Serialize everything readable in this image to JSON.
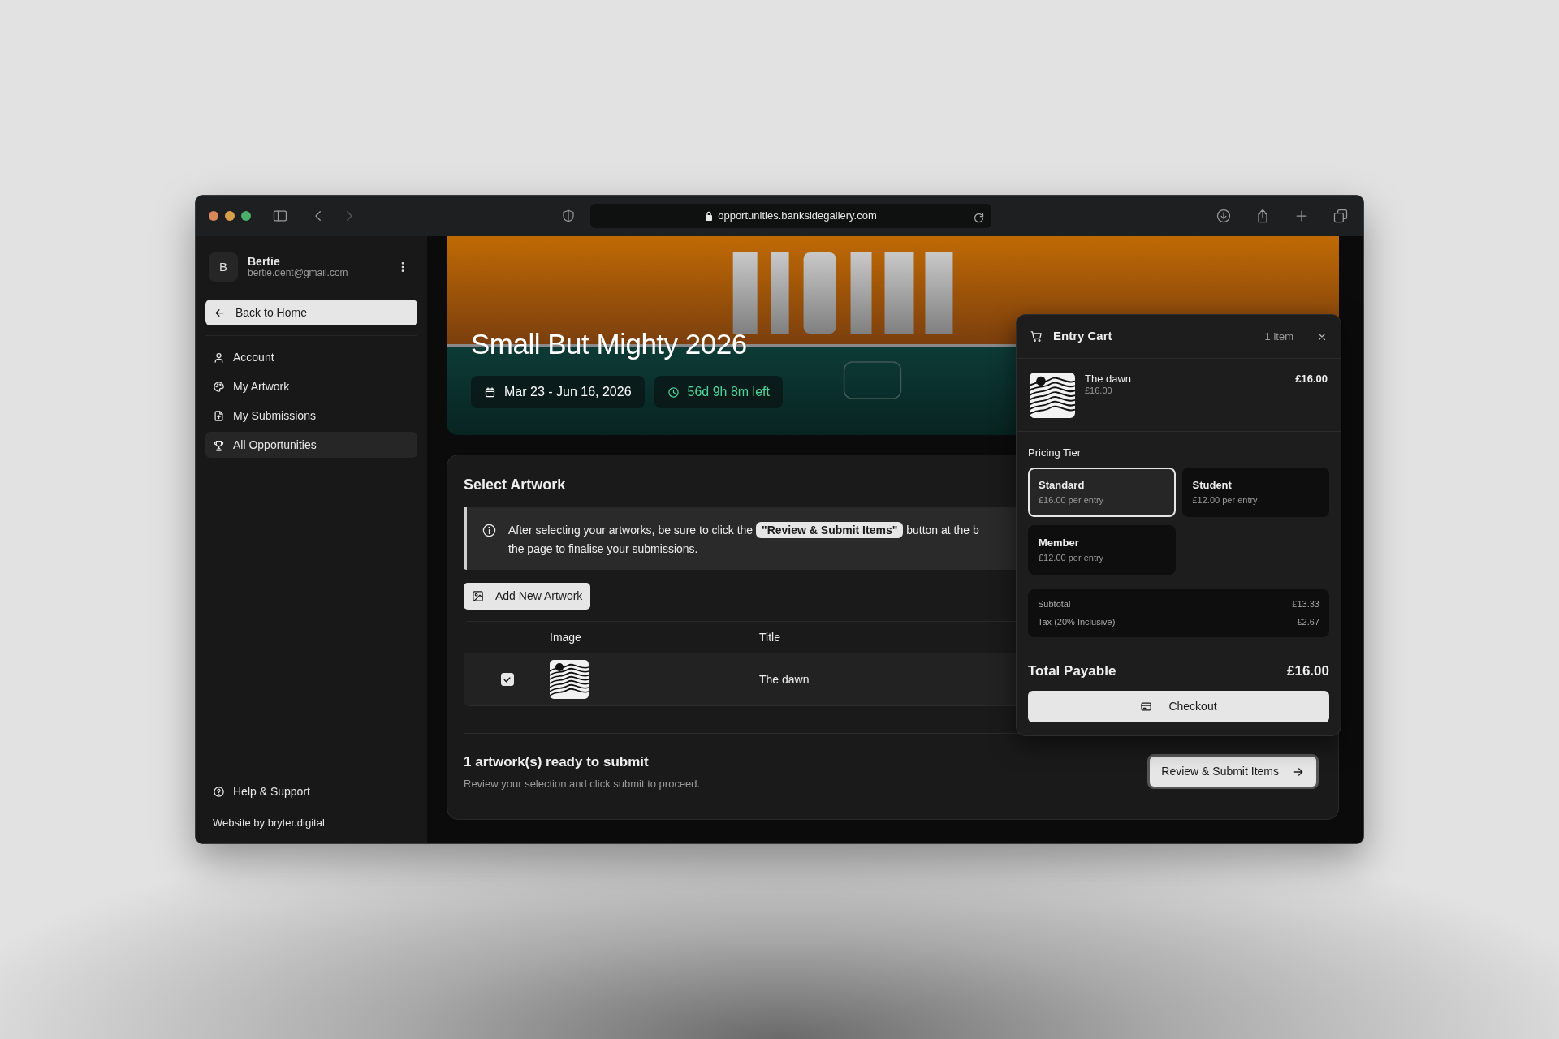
{
  "browser": {
    "url": "opportunities.banksidegallery.com"
  },
  "user": {
    "initial": "B",
    "name": "Bertie",
    "email": "bertie.dent@gmail.com"
  },
  "back_button": "Back to Home",
  "nav": [
    {
      "kind": "user",
      "label": "Account",
      "selected": false
    },
    {
      "kind": "palette",
      "label": "My Artwork",
      "selected": false
    },
    {
      "kind": "file",
      "label": "My Submissions",
      "selected": false
    },
    {
      "kind": "trophy",
      "label": "All Opportunities",
      "selected": true
    }
  ],
  "help": "Help & Support",
  "credit": "Website by bryter.digital",
  "banner": {
    "title": "Small But Mighty 2026",
    "dates": "Mar 23 - Jun 16, 2026",
    "countdown": "56d 9h 8m left"
  },
  "section": {
    "title": "Select Artwork",
    "info_lines": [
      "After selecting your artworks, be sure to click the **\"Review & Submit Items\"** button at the b",
      "the page to finalise your submissions."
    ],
    "add_button": "Add New Artwork",
    "table": {
      "columns": [
        "Image",
        "Title"
      ],
      "rows": [
        {
          "checked": true,
          "title": "The dawn"
        }
      ]
    },
    "summary": {
      "title": "1 artwork(s) ready to submit",
      "subtitle": "Review your selection and click submit to proceed.",
      "button": "Review & Submit Items"
    }
  },
  "cart": {
    "title": "Entry Cart",
    "count": "1 item",
    "items": [
      {
        "title": "The dawn",
        "unit_price": "£16.00",
        "price": "£16.00"
      }
    ],
    "tier_label": "Pricing Tier",
    "tiers": [
      {
        "name": "Standard",
        "price": "£16.00 per entry",
        "selected": true
      },
      {
        "name": "Student",
        "price": "£12.00 per entry",
        "selected": false
      },
      {
        "name": "Member",
        "price": "£12.00 per entry",
        "selected": false
      }
    ],
    "breakdown": [
      {
        "label": "Subtotal",
        "value": "£13.33"
      },
      {
        "label": "Tax (20% Inclusive)",
        "value": "£2.67"
      }
    ],
    "total_label": "Total Payable",
    "total": "£16.00",
    "checkout": "Checkout"
  }
}
